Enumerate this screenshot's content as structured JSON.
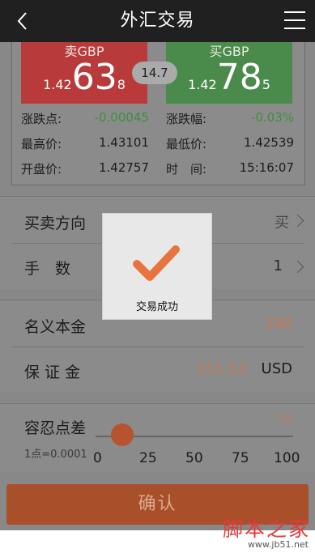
{
  "header": {
    "title": "外汇交易"
  },
  "quote": {
    "sell": {
      "label": "卖GBP",
      "prefix": "1.42",
      "big": "63",
      "suffix": "8"
    },
    "buy": {
      "label": "买GBP",
      "prefix": "1.42",
      "big": "78",
      "suffix": "5"
    },
    "spread": "14.7"
  },
  "stats": {
    "change_label": "涨跌点:",
    "change_value": "-0.00045",
    "change_pct_label": "涨跌幅:",
    "change_pct_value": "-0.03%",
    "high_label": "最高价:",
    "high_value": "1.43101",
    "low_label": "最低价:",
    "low_value": "1.42539",
    "open_label": "开盘价:",
    "open_value": "1.42757",
    "time_label": "时　间:",
    "time_value": "15:16:07"
  },
  "order": {
    "direction_label": "买卖方向",
    "direction_value": "买",
    "lots_label": "手　数",
    "lots_value": "1",
    "notional_label": "名义本金",
    "notional_value": "100",
    "margin_label": "保 证 金",
    "margin_value": "151.53",
    "margin_currency": "USD",
    "tolerance_label": "容忍点差",
    "tolerance_note": "1点=0.0001",
    "tolerance_value": "10",
    "slider_ticks": [
      "0",
      "25",
      "50",
      "75",
      "100"
    ],
    "slider_level_percent": 10
  },
  "confirm_label": "确认",
  "dialog": {
    "message": "交易成功"
  },
  "watermark": {
    "main": "脚本之家",
    "sub": "www.jb51.net"
  },
  "colors": {
    "sell": "#b93a3a",
    "buy": "#4a8a4a",
    "accent": "#b6552d",
    "negative": "#3f8f3f"
  }
}
